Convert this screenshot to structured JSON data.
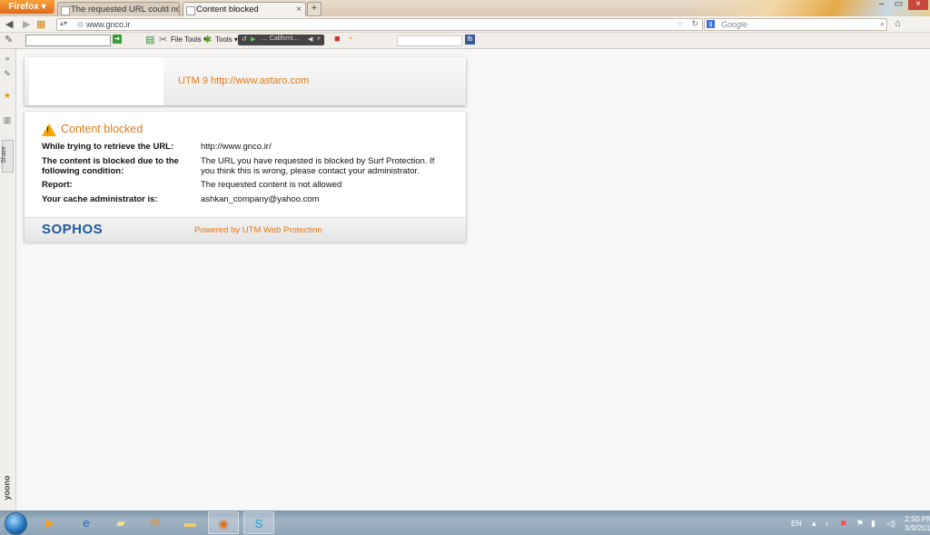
{
  "browser": {
    "menu_button": "Firefox",
    "tabs": [
      {
        "label": "The requested URL could not ..."
      },
      {
        "label": "Content blocked"
      }
    ],
    "new_tab": "+",
    "url": "www.gnco.ir",
    "search_placeholder": "Google",
    "toolbar": {
      "file_tools": "File Tools",
      "tools": "Tools",
      "player_track": "... Californi...",
      "fb": "fb"
    },
    "sidebar": {
      "share": "Share",
      "yoono": "yoono"
    }
  },
  "page": {
    "header_text": "UTM 9 http://www.astaro.com",
    "title": "Content blocked",
    "rows": [
      {
        "label": "While trying to retrieve the URL:",
        "value": "http://www.gnco.ir/"
      },
      {
        "label": "The content is blocked due to the following condition:",
        "value": "The URL you have requested is blocked by Surf Protection. If you think this is wrong, please contact your administrator."
      },
      {
        "label": "Report:",
        "value": "The requested content is not allowed"
      },
      {
        "label": "Your cache administrator is:",
        "value": "ashkan_company@yahoo.com"
      }
    ],
    "brand": "SOPHOS",
    "powered_by": "Powered by UTM Web Protection"
  },
  "taskbar": {
    "language": "EN",
    "time": "2:50 PM",
    "date": "3/9/2013"
  },
  "colors": {
    "accent_orange": "#e07a19",
    "sophos_blue": "#1e5a9c",
    "warning": "#f5a400"
  }
}
